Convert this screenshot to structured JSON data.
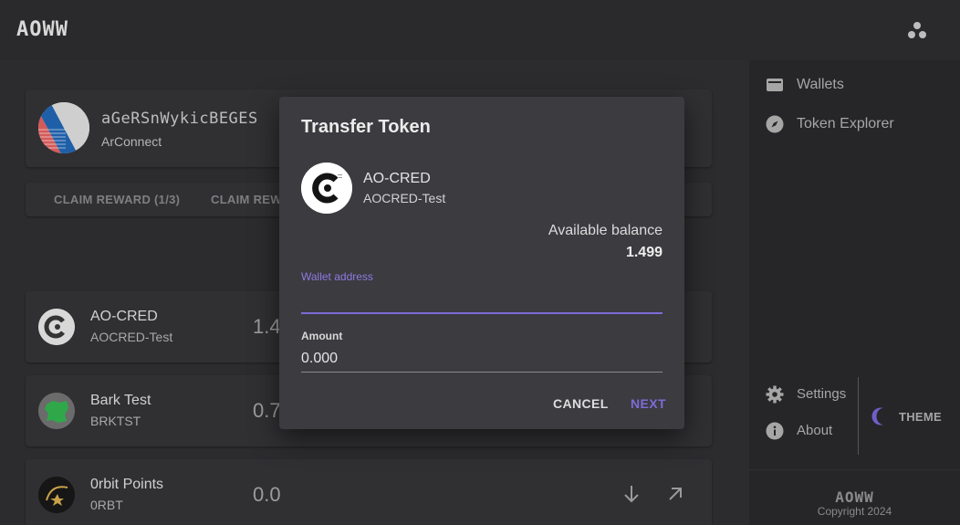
{
  "app": {
    "logo_text": "AOWW",
    "menu_icon": "apps-dots-icon"
  },
  "wallet": {
    "address": "aGeRSnWykicBEGES",
    "provider": "ArConnect",
    "actions": [
      "CLAIM REWARD (1/3)",
      "CLAIM REW"
    ]
  },
  "tokens": [
    {
      "name": "AO-CRED",
      "ticker": "AOCRED-Test",
      "balance": "1.4"
    },
    {
      "name": "Bark Test",
      "ticker": "BRKTST",
      "balance": "0.7"
    },
    {
      "name": "0rbit Points",
      "ticker": "0RBT",
      "balance": "0.0"
    }
  ],
  "sidebar": {
    "nav": [
      {
        "label": "Wallets",
        "icon": "wallet-icon"
      },
      {
        "label": "Token Explorer",
        "icon": "compass-icon"
      }
    ],
    "settings_label": "Settings",
    "about_label": "About",
    "theme_label": "THEME",
    "footer_logo": "AOWW",
    "copyright": "Copyright 2024"
  },
  "dialog": {
    "title": "Transfer Token",
    "token_name": "AO-CRED",
    "token_ticker": "AOCRED-Test",
    "available_label": "Available balance",
    "available_value": "1.499",
    "wallet_field_label": "Wallet address",
    "wallet_field_value": "",
    "amount_label": "Amount",
    "amount_value": "0.000",
    "cancel_label": "CANCEL",
    "next_label": "NEXT"
  },
  "colors": {
    "accent": "#7e6bd6",
    "dialog_bg": "#3b3b40",
    "background": "#242426"
  }
}
